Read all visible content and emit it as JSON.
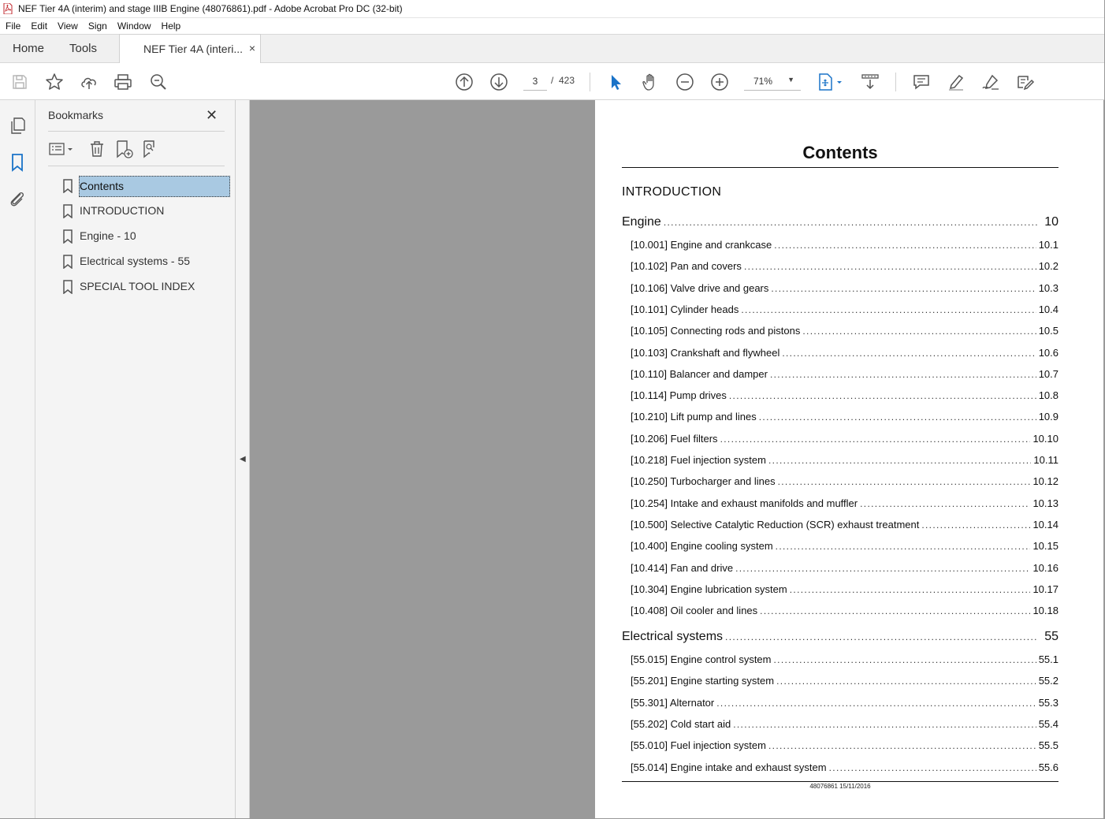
{
  "window": {
    "title": "NEF Tier 4A (interim) and stage IIIB Engine (48076861).pdf - Adobe Acrobat Pro DC (32-bit)"
  },
  "menu": {
    "items": [
      "File",
      "Edit",
      "View",
      "Sign",
      "Window",
      "Help"
    ]
  },
  "tabs": {
    "home": "Home",
    "tools": "Tools",
    "document": "NEF Tier 4A (interi...",
    "close": "×"
  },
  "toolbar": {
    "page_current": "3",
    "page_separator": "/",
    "page_total": "423",
    "zoom": "71%",
    "icons": [
      "save-icon",
      "bookmark-star-icon",
      "upload-icon",
      "print-icon",
      "find-zoom-icon",
      "previous-page-icon",
      "next-page-icon",
      "select-cursor-icon",
      "hand-icon",
      "zoom-out-icon",
      "zoom-in-icon",
      "fit-page-icon",
      "scroll-mode-icon",
      "comment-icon",
      "highlight-icon",
      "sign-icon",
      "fill-edit-icon"
    ]
  },
  "bookmarks": {
    "header": "Bookmarks",
    "close": "✕",
    "items": [
      {
        "label": "Contents",
        "selected": true
      },
      {
        "label": "INTRODUCTION",
        "selected": false
      },
      {
        "label": "Engine - 10",
        "selected": false
      },
      {
        "label": "Electrical systems - 55",
        "selected": false
      },
      {
        "label": "SPECIAL TOOL INDEX",
        "selected": false
      }
    ]
  },
  "document": {
    "title": "Contents",
    "intro": "INTRODUCTION",
    "sections": [
      {
        "name": "Engine",
        "num": "10",
        "entries": [
          {
            "text": "[10.001] Engine and crankcase",
            "num": "10.1"
          },
          {
            "text": "[10.102] Pan and covers",
            "num": "10.2"
          },
          {
            "text": "[10.106] Valve drive and gears",
            "num": "10.3"
          },
          {
            "text": "[10.101] Cylinder heads",
            "num": "10.4"
          },
          {
            "text": "[10.105] Connecting rods and pistons",
            "num": "10.5"
          },
          {
            "text": "[10.103] Crankshaft and flywheel",
            "num": "10.6"
          },
          {
            "text": "[10.110] Balancer and damper",
            "num": "10.7"
          },
          {
            "text": "[10.114] Pump drives",
            "num": "10.8"
          },
          {
            "text": "[10.210] Lift pump and lines",
            "num": "10.9"
          },
          {
            "text": "[10.206] Fuel filters",
            "num": "10.10"
          },
          {
            "text": "[10.218] Fuel injection system",
            "num": "10.11"
          },
          {
            "text": "[10.250] Turbocharger and lines",
            "num": "10.12"
          },
          {
            "text": "[10.254] Intake and exhaust manifolds and muffler",
            "num": "10.13"
          },
          {
            "text": "[10.500] Selective Catalytic Reduction (SCR) exhaust treatment",
            "num": "10.14"
          },
          {
            "text": "[10.400] Engine cooling system",
            "num": "10.15"
          },
          {
            "text": "[10.414] Fan and drive",
            "num": "10.16"
          },
          {
            "text": "[10.304] Engine lubrication system",
            "num": "10.17"
          },
          {
            "text": "[10.408] Oil cooler and lines",
            "num": "10.18"
          }
        ]
      },
      {
        "name": "Electrical systems",
        "num": "55",
        "entries": [
          {
            "text": "[55.015] Engine control system",
            "num": "55.1"
          },
          {
            "text": "[55.201] Engine starting system",
            "num": "55.2"
          },
          {
            "text": "[55.301] Alternator",
            "num": "55.3"
          },
          {
            "text": "[55.202] Cold start aid",
            "num": "55.4"
          },
          {
            "text": "[55.010] Fuel injection system",
            "num": "55.5"
          },
          {
            "text": "[55.014] Engine intake and exhaust system",
            "num": "55.6"
          }
        ]
      }
    ],
    "footer": "48076861 15/11/2016"
  },
  "colors": {
    "selection": "#a9c9e2",
    "accent_blue": "#1a73c8",
    "viewer_bg": "#9a9a9a"
  }
}
